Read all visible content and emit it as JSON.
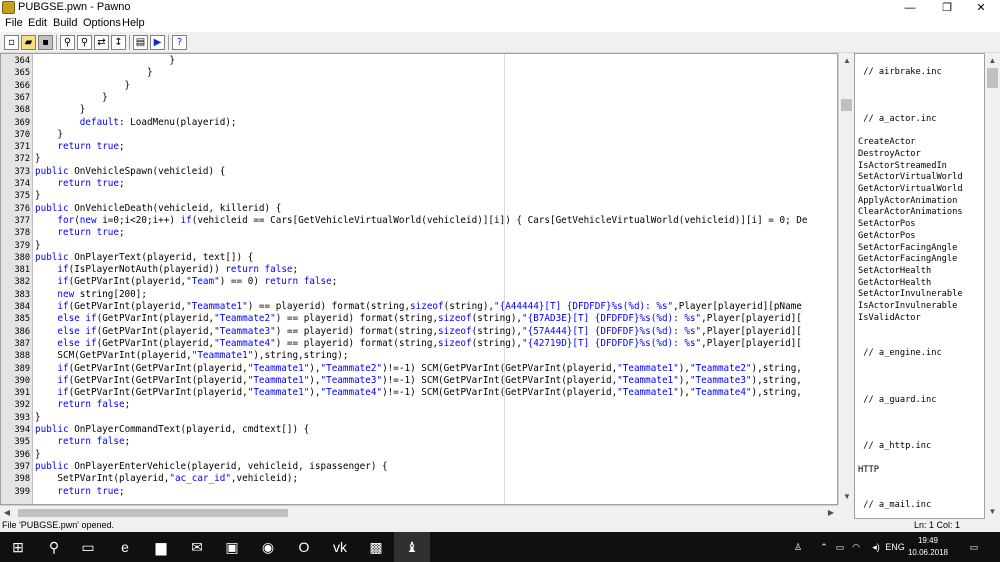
{
  "window": {
    "title": "PUBGSE.pwn - Pawno",
    "minimize": "—",
    "maximize": "❐",
    "close": "✕"
  },
  "menu": [
    "File",
    "Edit",
    "Build",
    "Options",
    "Help"
  ],
  "toolbar": {
    "icons": [
      "new-file-icon",
      "open-file-icon",
      "save-file-icon",
      "find-icon",
      "find-next-icon",
      "replace-icon",
      "goto-line-icon",
      "compile-icon",
      "run-icon",
      "help-icon"
    ]
  },
  "editor": {
    "lines": [
      {
        "n": "364",
        "code": "                        }"
      },
      {
        "n": "365",
        "code": "                    }"
      },
      {
        "n": "366",
        "code": "                }"
      },
      {
        "n": "367",
        "code": "            }"
      },
      {
        "n": "368",
        "code": "        }"
      },
      {
        "n": "369",
        "code": "        default: LoadMenu(playerid);"
      },
      {
        "n": "370",
        "code": "    }"
      },
      {
        "n": "371",
        "code": "    return true;"
      },
      {
        "n": "372",
        "code": "}"
      },
      {
        "n": "373",
        "code": "public OnVehicleSpawn(vehicleid) {"
      },
      {
        "n": "374",
        "code": "    return true;"
      },
      {
        "n": "375",
        "code": "}"
      },
      {
        "n": "376",
        "code": "public OnVehicleDeath(vehicleid, killerid) {"
      },
      {
        "n": "377",
        "code": "    for(new i=0;i<20;i++) if(vehicleid == Cars[GetVehicleVirtualWorld(vehicleid)][i]) { Cars[GetVehicleVirtualWorld(vehicleid)][i] = 0; De"
      },
      {
        "n": "378",
        "code": "    return true;"
      },
      {
        "n": "379",
        "code": "}"
      },
      {
        "n": "380",
        "code": "public OnPlayerText(playerid, text[]) {"
      },
      {
        "n": "381",
        "code": "    if(IsPlayerNotAuth(playerid)) return false;"
      },
      {
        "n": "382",
        "code": "    if(GetPVarInt(playerid,\"Team\") == 0) return false;"
      },
      {
        "n": "383",
        "code": "    new string[200];"
      },
      {
        "n": "384",
        "code": "    if(GetPVarInt(playerid,\"Teammate1\") == playerid) format(string,sizeof(string),\"{A44444}[T] {DFDFDF}%s(%d): %s\",Player[playerid][pName"
      },
      {
        "n": "385",
        "code": "    else if(GetPVarInt(playerid,\"Teammate2\") == playerid) format(string,sizeof(string),\"{B7AD3E}[T] {DFDFDF}%s(%d): %s\",Player[playerid]["
      },
      {
        "n": "386",
        "code": "    else if(GetPVarInt(playerid,\"Teammate3\") == playerid) format(string,sizeof(string),\"{57A444}[T] {DFDFDF}%s(%d): %s\",Player[playerid]["
      },
      {
        "n": "387",
        "code": "    else if(GetPVarInt(playerid,\"Teammate4\") == playerid) format(string,sizeof(string),\"{42719D}[T] {DFDFDF}%s(%d): %s\",Player[playerid]["
      },
      {
        "n": "388",
        "code": "    SCM(GetPVarInt(playerid,\"Teammate1\"),string,string);"
      },
      {
        "n": "389",
        "code": "    if(GetPVarInt(GetPVarInt(playerid,\"Teammate1\"),\"Teammate2\")!=-1) SCM(GetPVarInt(GetPVarInt(playerid,\"Teammate1\"),\"Teammate2\"),string,"
      },
      {
        "n": "390",
        "code": "    if(GetPVarInt(GetPVarInt(playerid,\"Teammate1\"),\"Teammate3\")!=-1) SCM(GetPVarInt(GetPVarInt(playerid,\"Teammate1\"),\"Teammate3\"),string,"
      },
      {
        "n": "391",
        "code": "    if(GetPVarInt(GetPVarInt(playerid,\"Teammate1\"),\"Teammate4\")!=-1) SCM(GetPVarInt(GetPVarInt(playerid,\"Teammate1\"),\"Teammate4\"),string,"
      },
      {
        "n": "392",
        "code": "    return false;"
      },
      {
        "n": "393",
        "code": "}"
      },
      {
        "n": "394",
        "code": "public OnPlayerCommandText(playerid, cmdtext[]) {"
      },
      {
        "n": "395",
        "code": "    return false;"
      },
      {
        "n": "396",
        "code": "}"
      },
      {
        "n": "397",
        "code": "public OnPlayerEnterVehicle(playerid, vehicleid, ispassenger) {"
      },
      {
        "n": "398",
        "code": "    SetPVarInt(playerid,\"ac_car_id\",vehicleid);"
      },
      {
        "n": "399",
        "code": "    return true;"
      }
    ]
  },
  "function_list": [
    " // airbrake.inc",
    "",
    "",
    "",
    " // a_actor.inc",
    "",
    "CreateActor",
    "DestroyActor",
    "IsActorStreamedIn",
    "SetActorVirtualWorld",
    "GetActorVirtualWorld",
    "ApplyActorAnimation",
    "ClearActorAnimations",
    "SetActorPos",
    "GetActorPos",
    "SetActorFacingAngle",
    "GetActorFacingAngle",
    "SetActorHealth",
    "GetActorHealth",
    "SetActorInvulnerable",
    "IsActorInvulnerable",
    "IsValidActor",
    "",
    "",
    " // a_engine.inc",
    "",
    "",
    "",
    " // a_guard.inc",
    "",
    "",
    "",
    " // a_http.inc",
    "",
    "HTTP",
    "",
    "",
    " // a_mail.inc"
  ],
  "status": {
    "message": "File 'PUBGSE.pwn' opened.",
    "position": "Ln: 1  Col: 1"
  },
  "taskbar": {
    "apps": [
      {
        "name": "start-button",
        "glyph": "⊞"
      },
      {
        "name": "search-icon",
        "glyph": "⚲"
      },
      {
        "name": "task-view-icon",
        "glyph": "▭"
      },
      {
        "name": "edge-icon",
        "glyph": "e"
      },
      {
        "name": "file-explorer-icon",
        "glyph": "▆"
      },
      {
        "name": "mail-icon",
        "glyph": "✉"
      },
      {
        "name": "store-icon",
        "glyph": "▣"
      },
      {
        "name": "chrome-icon",
        "glyph": "◉"
      },
      {
        "name": "opera-icon",
        "glyph": "O"
      },
      {
        "name": "vk-icon",
        "glyph": "vk"
      },
      {
        "name": "game-app-icon",
        "glyph": "▩"
      },
      {
        "name": "pawno-app-icon",
        "glyph": "♝"
      }
    ],
    "lang": "ENG",
    "time": "19:49",
    "date": "10.06.2018"
  },
  "colors": {
    "keyword": "#0000ff",
    "string": "#0000ff"
  }
}
